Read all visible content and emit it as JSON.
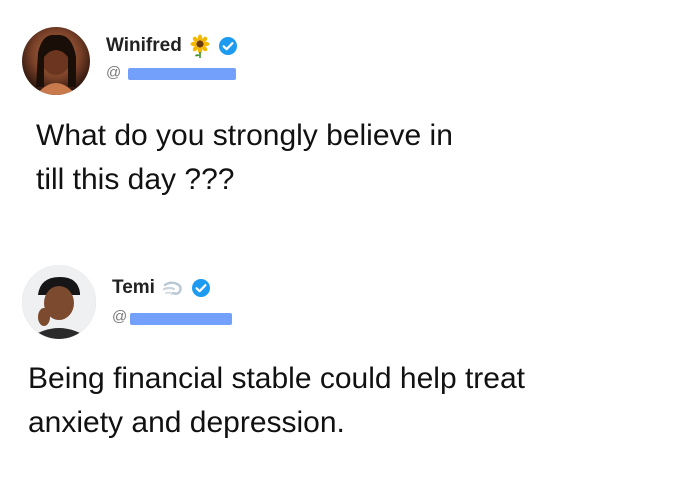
{
  "tweets": [
    {
      "user": {
        "name": "Winifred",
        "handle": "@",
        "emoji_icon": "sunflower-icon",
        "verified_icon": "verified-badge-icon"
      },
      "text": "What do you strongly believe in\ntill this day ???"
    },
    {
      "user": {
        "name": "Temi",
        "handle": "@",
        "emoji_icon": "dash-icon",
        "verified_icon": "verified-badge-icon"
      },
      "text": "Being financial stable could help treat\nanxiety and depression."
    }
  ],
  "colors": {
    "verified_blue": "#1d9bf0",
    "redaction_blue": "#5b8ff9",
    "text": "#111111",
    "handle_gray": "#7a7a7a"
  }
}
